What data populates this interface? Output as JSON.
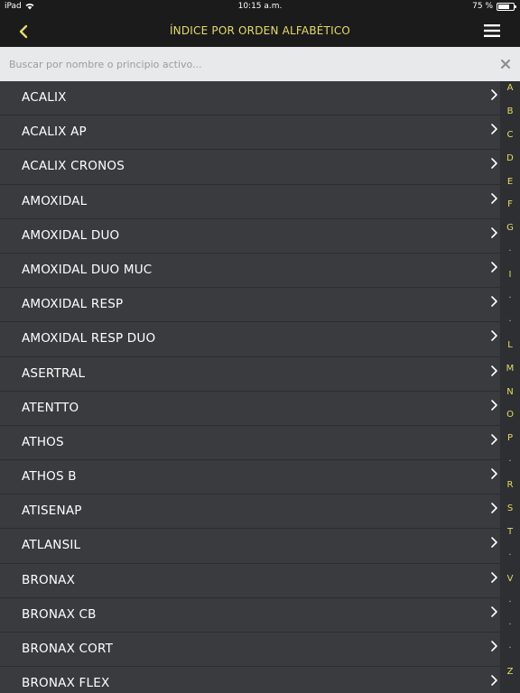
{
  "status": {
    "device": "iPad",
    "time": "10:15 a.m.",
    "battery": "75 %",
    "battery_level": 0.75
  },
  "header": {
    "title": "ÍNDICE POR ORDEN ALFABÉTICO"
  },
  "search": {
    "placeholder": "Buscar por nombre o principio activo..."
  },
  "list": [
    "ACALIX",
    "ACALIX AP",
    "ACALIX CRONOS",
    "AMOXIDAL",
    "AMOXIDAL DUO",
    "AMOXIDAL DUO MUC",
    "AMOXIDAL RESP",
    "AMOXIDAL RESP DUO",
    "ASERTRAL",
    "ATENTTO",
    "ATHOS",
    "ATHOS B",
    "ATISENAP",
    "ATLANSIL",
    "BRONAX",
    "BRONAX CB",
    "BRONAX CORT",
    "BRONAX FLEX"
  ],
  "index": [
    "A",
    "B",
    "C",
    "D",
    "E",
    "F",
    "G",
    "·",
    "I",
    "·",
    "·",
    "L",
    "M",
    "N",
    "O",
    "P",
    "·",
    "R",
    "S",
    "T",
    "·",
    "V",
    "·",
    "·",
    "·",
    "Z"
  ],
  "colors": {
    "accent": "#e5dc63",
    "bar": "#1b1b1c",
    "row_bg": "#3a3b3f"
  }
}
